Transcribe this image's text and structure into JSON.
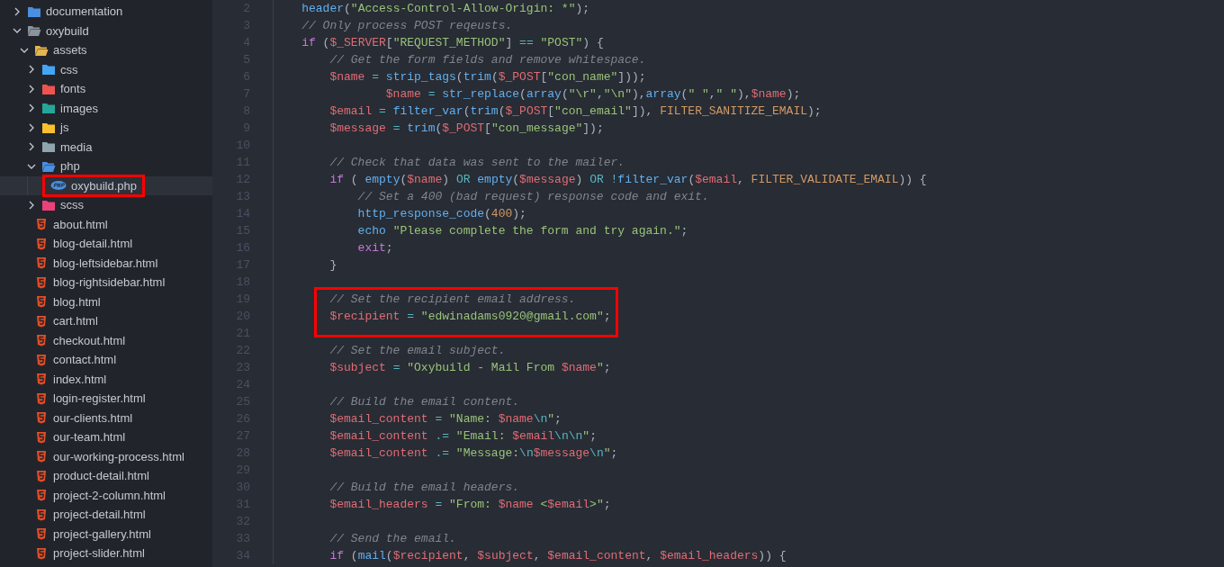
{
  "explorer": {
    "items": [
      {
        "kind": "folder",
        "name": "documentation",
        "color": "#4a8fe0",
        "expanded": false,
        "selected": false,
        "boxed": false
      },
      {
        "kind": "folder",
        "name": "oxybuild",
        "color": "#8b949e",
        "expanded": true,
        "selected": false,
        "boxed": false,
        "children": [
          {
            "kind": "folder",
            "name": "assets",
            "color": "#e6b450",
            "expanded": true,
            "selected": false,
            "boxed": false,
            "children": [
              {
                "kind": "folder",
                "name": "css",
                "color": "#42a5f5",
                "expanded": false,
                "selected": false,
                "boxed": false
              },
              {
                "kind": "folder",
                "name": "fonts",
                "color": "#ef5350",
                "expanded": false,
                "selected": false,
                "boxed": false
              },
              {
                "kind": "folder",
                "name": "images",
                "color": "#26a69a",
                "expanded": false,
                "selected": false,
                "boxed": false
              },
              {
                "kind": "folder",
                "name": "js",
                "color": "#fbc02d",
                "expanded": false,
                "selected": false,
                "boxed": false
              },
              {
                "kind": "folder",
                "name": "media",
                "color": "#90a4ae",
                "expanded": false,
                "selected": false,
                "boxed": false
              },
              {
                "kind": "folder",
                "name": "php",
                "color": "#4a8fe0",
                "expanded": true,
                "selected": false,
                "boxed": false,
                "children": [
                  {
                    "kind": "php-file",
                    "name": "oxybuild.php",
                    "selected": true,
                    "boxed": true
                  }
                ]
              },
              {
                "kind": "folder",
                "name": "scss",
                "color": "#ec407a",
                "expanded": false,
                "selected": false,
                "boxed": false
              }
            ]
          },
          {
            "kind": "html-file",
            "name": "about.html",
            "selected": false,
            "boxed": false
          },
          {
            "kind": "html-file",
            "name": "blog-detail.html",
            "selected": false,
            "boxed": false
          },
          {
            "kind": "html-file",
            "name": "blog-leftsidebar.html",
            "selected": false,
            "boxed": false
          },
          {
            "kind": "html-file",
            "name": "blog-rightsidebar.html",
            "selected": false,
            "boxed": false
          },
          {
            "kind": "html-file",
            "name": "blog.html",
            "selected": false,
            "boxed": false
          },
          {
            "kind": "html-file",
            "name": "cart.html",
            "selected": false,
            "boxed": false
          },
          {
            "kind": "html-file",
            "name": "checkout.html",
            "selected": false,
            "boxed": false
          },
          {
            "kind": "html-file",
            "name": "contact.html",
            "selected": false,
            "boxed": false
          },
          {
            "kind": "html-file",
            "name": "index.html",
            "selected": false,
            "boxed": false
          },
          {
            "kind": "html-file",
            "name": "login-register.html",
            "selected": false,
            "boxed": false
          },
          {
            "kind": "html-file",
            "name": "our-clients.html",
            "selected": false,
            "boxed": false
          },
          {
            "kind": "html-file",
            "name": "our-team.html",
            "selected": false,
            "boxed": false
          },
          {
            "kind": "html-file",
            "name": "our-working-process.html",
            "selected": false,
            "boxed": false
          },
          {
            "kind": "html-file",
            "name": "product-detail.html",
            "selected": false,
            "boxed": false
          },
          {
            "kind": "html-file",
            "name": "project-2-column.html",
            "selected": false,
            "boxed": false
          },
          {
            "kind": "html-file",
            "name": "project-detail.html",
            "selected": false,
            "boxed": false
          },
          {
            "kind": "html-file",
            "name": "project-gallery.html",
            "selected": false,
            "boxed": false
          },
          {
            "kind": "html-file",
            "name": "project-slider.html",
            "selected": false,
            "boxed": false
          }
        ]
      }
    ]
  },
  "code": {
    "lines": [
      {
        "number": "2",
        "boxed": false,
        "tokens": [
          {
            "kind": "f",
            "text": "    header"
          },
          {
            "kind": "p",
            "text": "("
          },
          {
            "kind": "s",
            "text": "\"Access-Control-Allow-Origin: *\""
          },
          {
            "kind": "p",
            "text": ");"
          }
        ]
      },
      {
        "number": "3",
        "boxed": false,
        "tokens": [
          {
            "kind": "c",
            "text": "    // Only process POST reqeusts."
          }
        ]
      },
      {
        "number": "4",
        "boxed": false,
        "tokens": [
          {
            "kind": "k",
            "text": "    if"
          },
          {
            "kind": "p",
            "text": " ("
          },
          {
            "kind": "v",
            "text": "$_SERVER"
          },
          {
            "kind": "p",
            "text": "["
          },
          {
            "kind": "s",
            "text": "\"REQUEST_METHOD\""
          },
          {
            "kind": "p",
            "text": "] "
          },
          {
            "kind": "o",
            "text": "== "
          },
          {
            "kind": "s",
            "text": "\"POST\""
          },
          {
            "kind": "p",
            "text": ") {"
          }
        ]
      },
      {
        "number": "5",
        "boxed": false,
        "tokens": [
          {
            "kind": "c",
            "text": "        // Get the form fields and remove whitespace."
          }
        ]
      },
      {
        "number": "6",
        "boxed": false,
        "tokens": [
          {
            "kind": "v",
            "text": "        $name"
          },
          {
            "kind": "o",
            "text": " = "
          },
          {
            "kind": "f",
            "text": "strip_tags"
          },
          {
            "kind": "p",
            "text": "("
          },
          {
            "kind": "f",
            "text": "trim"
          },
          {
            "kind": "p",
            "text": "("
          },
          {
            "kind": "v",
            "text": "$_POST"
          },
          {
            "kind": "p",
            "text": "["
          },
          {
            "kind": "s",
            "text": "\"con_name\""
          },
          {
            "kind": "p",
            "text": "]));"
          }
        ]
      },
      {
        "number": "7",
        "boxed": false,
        "tokens": [
          {
            "kind": "v",
            "text": "                $name"
          },
          {
            "kind": "o",
            "text": " = "
          },
          {
            "kind": "f",
            "text": "str_replace"
          },
          {
            "kind": "p",
            "text": "("
          },
          {
            "kind": "f",
            "text": "array"
          },
          {
            "kind": "p",
            "text": "("
          },
          {
            "kind": "s",
            "text": "\"\\r\""
          },
          {
            "kind": "p",
            "text": ","
          },
          {
            "kind": "s",
            "text": "\"\\n\""
          },
          {
            "kind": "p",
            "text": "),"
          },
          {
            "kind": "f",
            "text": "array"
          },
          {
            "kind": "p",
            "text": "("
          },
          {
            "kind": "s",
            "text": "\" \""
          },
          {
            "kind": "p",
            "text": ","
          },
          {
            "kind": "s",
            "text": "\" \""
          },
          {
            "kind": "p",
            "text": "),"
          },
          {
            "kind": "v",
            "text": "$name"
          },
          {
            "kind": "p",
            "text": ");"
          }
        ]
      },
      {
        "number": "8",
        "boxed": false,
        "tokens": [
          {
            "kind": "v",
            "text": "        $email"
          },
          {
            "kind": "o",
            "text": " = "
          },
          {
            "kind": "f",
            "text": "filter_var"
          },
          {
            "kind": "p",
            "text": "("
          },
          {
            "kind": "f",
            "text": "trim"
          },
          {
            "kind": "p",
            "text": "("
          },
          {
            "kind": "v",
            "text": "$_POST"
          },
          {
            "kind": "p",
            "text": "["
          },
          {
            "kind": "s",
            "text": "\"con_email\""
          },
          {
            "kind": "p",
            "text": "]), "
          },
          {
            "kind": "n",
            "text": "FILTER_SANITIZE_EMAIL"
          },
          {
            "kind": "p",
            "text": ");"
          }
        ]
      },
      {
        "number": "9",
        "boxed": false,
        "tokens": [
          {
            "kind": "v",
            "text": "        $message"
          },
          {
            "kind": "o",
            "text": " = "
          },
          {
            "kind": "f",
            "text": "trim"
          },
          {
            "kind": "p",
            "text": "("
          },
          {
            "kind": "v",
            "text": "$_POST"
          },
          {
            "kind": "p",
            "text": "["
          },
          {
            "kind": "s",
            "text": "\"con_message\""
          },
          {
            "kind": "p",
            "text": "]);"
          }
        ]
      },
      {
        "number": "10",
        "boxed": false
      },
      {
        "number": "11",
        "boxed": false,
        "tokens": [
          {
            "kind": "c",
            "text": "        // Check that data was sent to the mailer."
          }
        ]
      },
      {
        "number": "12",
        "boxed": false,
        "tokens": [
          {
            "kind": "k",
            "text": "        if"
          },
          {
            "kind": "p",
            "text": " ( "
          },
          {
            "kind": "f",
            "text": "empty"
          },
          {
            "kind": "p",
            "text": "("
          },
          {
            "kind": "v",
            "text": "$name"
          },
          {
            "kind": "p",
            "text": ") "
          },
          {
            "kind": "o",
            "text": "OR "
          },
          {
            "kind": "f",
            "text": "empty"
          },
          {
            "kind": "p",
            "text": "("
          },
          {
            "kind": "v",
            "text": "$message"
          },
          {
            "kind": "p",
            "text": ") "
          },
          {
            "kind": "o",
            "text": "OR !"
          },
          {
            "kind": "f",
            "text": "filter_var"
          },
          {
            "kind": "p",
            "text": "("
          },
          {
            "kind": "v",
            "text": "$email"
          },
          {
            "kind": "p",
            "text": ", "
          },
          {
            "kind": "n",
            "text": "FILTER_VALIDATE_EMAIL"
          },
          {
            "kind": "p",
            "text": ")) {"
          }
        ]
      },
      {
        "number": "13",
        "boxed": false,
        "tokens": [
          {
            "kind": "c",
            "text": "            // Set a 400 (bad request) response code and exit."
          }
        ]
      },
      {
        "number": "14",
        "boxed": false,
        "tokens": [
          {
            "kind": "f",
            "text": "            http_response_code"
          },
          {
            "kind": "p",
            "text": "("
          },
          {
            "kind": "n",
            "text": "400"
          },
          {
            "kind": "p",
            "text": ");"
          }
        ]
      },
      {
        "number": "15",
        "boxed": false,
        "tokens": [
          {
            "kind": "f",
            "text": "            echo"
          },
          {
            "kind": "s",
            "text": " \"Please complete the form and try again.\""
          },
          {
            "kind": "p",
            "text": ";"
          }
        ]
      },
      {
        "number": "16",
        "boxed": false,
        "tokens": [
          {
            "kind": "k",
            "text": "            exit"
          },
          {
            "kind": "p",
            "text": ";"
          }
        ]
      },
      {
        "number": "17",
        "boxed": false,
        "tokens": [
          {
            "kind": "p",
            "text": "        }"
          }
        ]
      },
      {
        "number": "18",
        "boxed": false
      },
      {
        "number": "19",
        "boxed": true,
        "tokens": [
          {
            "kind": "c",
            "text": "        // Set the recipient email address."
          }
        ]
      },
      {
        "number": "20",
        "boxed": true,
        "tokens": [
          {
            "kind": "v",
            "text": "        $recipient"
          },
          {
            "kind": "o",
            "text": " = "
          },
          {
            "kind": "s",
            "text": "\"edwinadams0920@gmail.com\""
          },
          {
            "kind": "p",
            "text": ";"
          }
        ]
      },
      {
        "number": "21",
        "boxed": true
      },
      {
        "number": "22",
        "boxed": false,
        "tokens": [
          {
            "kind": "c",
            "text": "        // Set the email subject."
          }
        ]
      },
      {
        "number": "23",
        "boxed": false,
        "tokens": [
          {
            "kind": "v",
            "text": "        $subject"
          },
          {
            "kind": "o",
            "text": " = "
          },
          {
            "kind": "s",
            "text": "\"Oxybuild - Mail From "
          },
          {
            "kind": "v",
            "text": "$name"
          },
          {
            "kind": "s",
            "text": "\""
          },
          {
            "kind": "p",
            "text": ";"
          }
        ]
      },
      {
        "number": "24",
        "boxed": false
      },
      {
        "number": "25",
        "boxed": false,
        "tokens": [
          {
            "kind": "c",
            "text": "        // Build the email content."
          }
        ]
      },
      {
        "number": "26",
        "boxed": false,
        "tokens": [
          {
            "kind": "v",
            "text": "        $email_content"
          },
          {
            "kind": "o",
            "text": " = "
          },
          {
            "kind": "s",
            "text": "\"Name: "
          },
          {
            "kind": "v",
            "text": "$name"
          },
          {
            "kind": "e",
            "text": "\\n"
          },
          {
            "kind": "s",
            "text": "\""
          },
          {
            "kind": "p",
            "text": ";"
          }
        ]
      },
      {
        "number": "27",
        "boxed": false,
        "tokens": [
          {
            "kind": "v",
            "text": "        $email_content"
          },
          {
            "kind": "o",
            "text": " .= "
          },
          {
            "kind": "s",
            "text": "\"Email: "
          },
          {
            "kind": "v",
            "text": "$email"
          },
          {
            "kind": "e",
            "text": "\\n\\n"
          },
          {
            "kind": "s",
            "text": "\""
          },
          {
            "kind": "p",
            "text": ";"
          }
        ]
      },
      {
        "number": "28",
        "boxed": false,
        "tokens": [
          {
            "kind": "v",
            "text": "        $email_content"
          },
          {
            "kind": "o",
            "text": " .= "
          },
          {
            "kind": "s",
            "text": "\"Message:"
          },
          {
            "kind": "e",
            "text": "\\n"
          },
          {
            "kind": "v",
            "text": "$message"
          },
          {
            "kind": "e",
            "text": "\\n"
          },
          {
            "kind": "s",
            "text": "\""
          },
          {
            "kind": "p",
            "text": ";"
          }
        ]
      },
      {
        "number": "29",
        "boxed": false
      },
      {
        "number": "30",
        "boxed": false,
        "tokens": [
          {
            "kind": "c",
            "text": "        // Build the email headers."
          }
        ]
      },
      {
        "number": "31",
        "boxed": false,
        "tokens": [
          {
            "kind": "v",
            "text": "        $email_headers"
          },
          {
            "kind": "o",
            "text": " = "
          },
          {
            "kind": "s",
            "text": "\"From: "
          },
          {
            "kind": "v",
            "text": "$name"
          },
          {
            "kind": "s",
            "text": " <"
          },
          {
            "kind": "v",
            "text": "$email"
          },
          {
            "kind": "s",
            "text": ">\""
          },
          {
            "kind": "p",
            "text": ";"
          }
        ]
      },
      {
        "number": "32",
        "boxed": false
      },
      {
        "number": "33",
        "boxed": false,
        "tokens": [
          {
            "kind": "c",
            "text": "        // Send the email."
          }
        ]
      },
      {
        "number": "34",
        "boxed": false,
        "tokens": [
          {
            "kind": "k",
            "text": "        if"
          },
          {
            "kind": "p",
            "text": " ("
          },
          {
            "kind": "f",
            "text": "mail"
          },
          {
            "kind": "p",
            "text": "("
          },
          {
            "kind": "v",
            "text": "$recipient"
          },
          {
            "kind": "p",
            "text": ", "
          },
          {
            "kind": "v",
            "text": "$subject"
          },
          {
            "kind": "p",
            "text": ", "
          },
          {
            "kind": "v",
            "text": "$email_content"
          },
          {
            "kind": "p",
            "text": ", "
          },
          {
            "kind": "v",
            "text": "$email_headers"
          },
          {
            "kind": "p",
            "text": ")) {"
          }
        ]
      }
    ]
  }
}
